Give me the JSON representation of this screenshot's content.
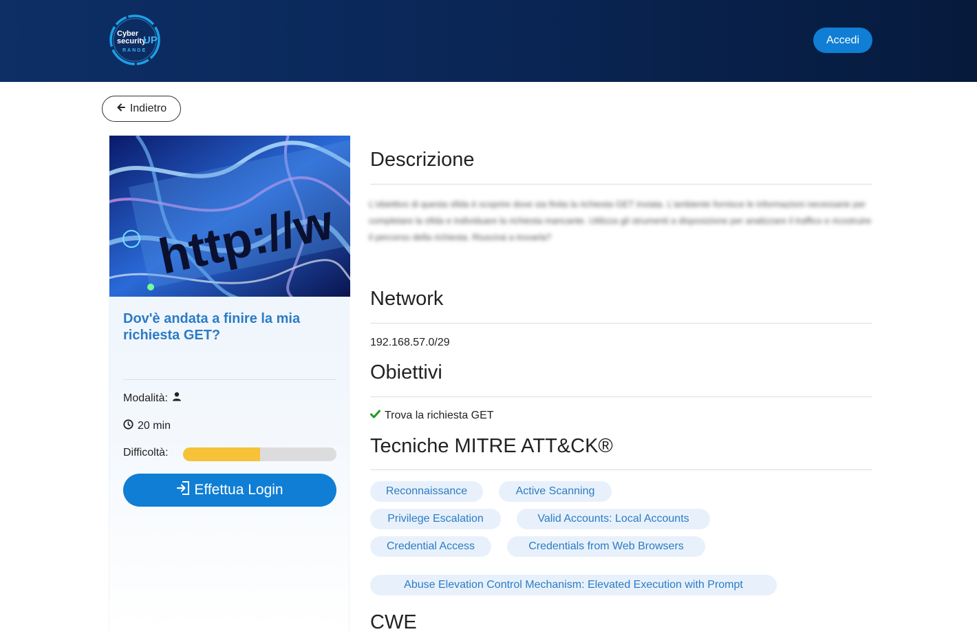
{
  "header": {
    "logo_line1": "Cyber",
    "logo_line2": "security",
    "logo_up": "UP",
    "logo_line3": "RANGE",
    "login_label": "Accedi"
  },
  "nav": {
    "back_label": "Indietro"
  },
  "card": {
    "image_text": "http://w",
    "title": "Dov'è andata a finire la mia richiesta GET?",
    "mode_label": "Modalità:",
    "duration": "20 min",
    "difficulty_label": "Difficoltà:",
    "difficulty_level": 0.5,
    "login_button": "Effettua Login"
  },
  "sections": {
    "description_title": "Descrizione",
    "description_text": "L'obiettivo di questa sfida è scoprire dove sia finita la richiesta GET inviata. L'ambiente fornisce le informazioni necessarie per completare la sfida e individuare la richiesta mancante. Utilizza gli strumenti a disposizione per analizzare il traffico e ricostruire il percorso della richiesta. Riuscirai a trovarla?",
    "network_title": "Network",
    "network_value": "192.168.57.0/29",
    "objectives_title": "Obiettivi",
    "objectives": [
      "Trova la richiesta GET"
    ],
    "mitre_title": "Tecniche MITRE ATT&CK®",
    "mitre_tags": [
      "Reconnaissance",
      "Active Scanning",
      "Privilege Escalation",
      "Valid Accounts: Local Accounts",
      "Credential Access",
      "Credentials from Web Browsers",
      "Abuse Elevation Control Mechanism: Elevated Execution with Prompt"
    ],
    "cwe_title": "CWE"
  },
  "colors": {
    "header_bg": "#0a2656",
    "accent": "#0f7ed4",
    "title_blue": "#2b7bc4",
    "difficulty_fill": "#f5c23a",
    "check_green": "#1d9a1d"
  }
}
